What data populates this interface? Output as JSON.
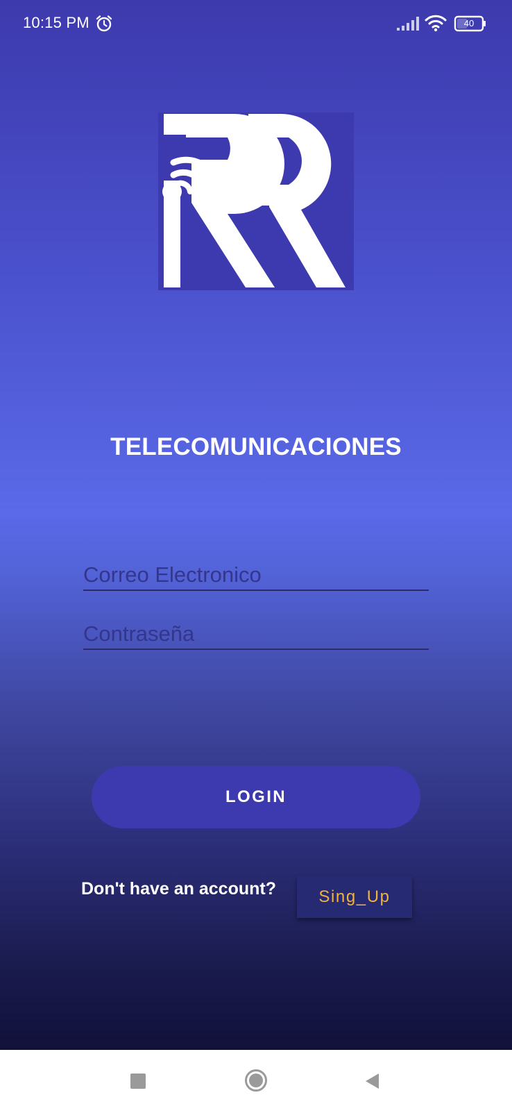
{
  "status_bar": {
    "time": "10:15 PM",
    "battery": "40",
    "icons": [
      "alarm-icon",
      "signal-icon",
      "wifi-icon",
      "battery-icon"
    ]
  },
  "logo": {
    "icon": "rr-logo"
  },
  "brand_title": "TELECOMUNICACIONES",
  "form": {
    "email_placeholder": "Correo Electronico",
    "email_value": "",
    "password_placeholder": "Contraseña",
    "password_value": ""
  },
  "login_button": "LOGIN",
  "signup": {
    "prompt": "Don't have an account?",
    "button": "Sing_Up"
  },
  "nav_bar": {
    "icons": [
      "recents-icon",
      "home-icon",
      "back-icon"
    ]
  },
  "colors": {
    "background_top": "#3d3aad",
    "background_mid": "#5a6ae8",
    "background_bottom": "#11113a",
    "login_button": "#3c3aae",
    "signup_text": "#f2b33c",
    "signup_button": "#262a72"
  }
}
